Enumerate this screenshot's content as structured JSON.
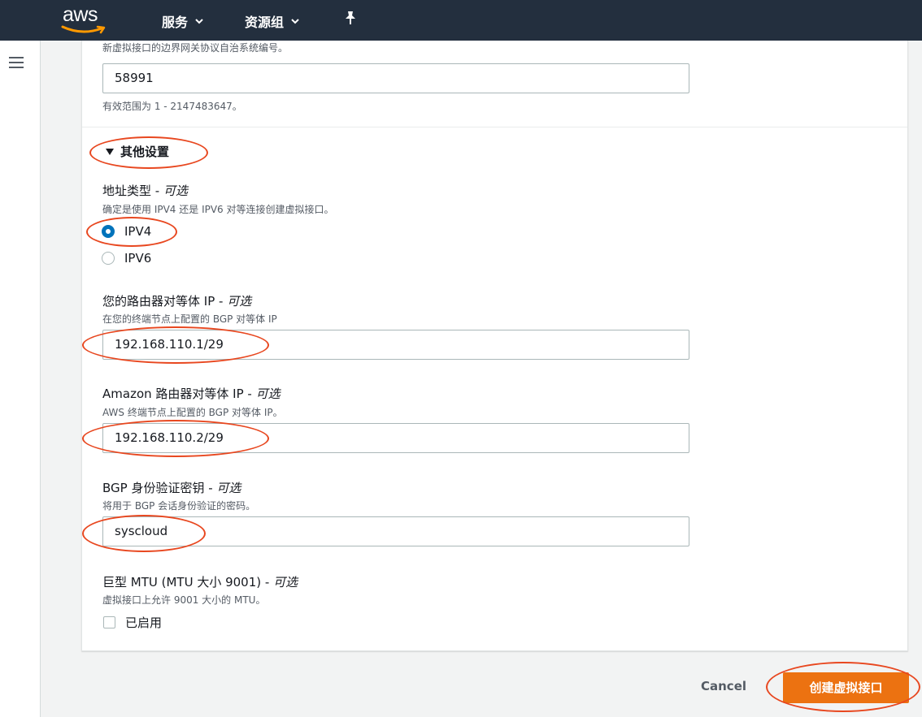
{
  "nav": {
    "logo_text": "aws",
    "services_label": "服务",
    "resource_groups_label": "资源组"
  },
  "asn": {
    "description": "新虚拟接口的边界网关协议自治系统编号。",
    "value": "58991",
    "hint": "有效范围为 1 - 2147483647。"
  },
  "other_settings": {
    "label": "其他设置"
  },
  "address_type": {
    "label": "地址类型 - ",
    "optional": "可选",
    "description": "确定是使用 IPV4 还是 IPV6 对等连接创建虚拟接口。",
    "options": [
      {
        "label": "IPV4",
        "selected": true
      },
      {
        "label": "IPV6",
        "selected": false
      }
    ]
  },
  "router_peer_ip": {
    "label": "您的路由器对等体 IP - ",
    "optional": "可选",
    "description": "在您的终端节点上配置的 BGP 对等体 IP",
    "value": "192.168.110.1/29"
  },
  "amazon_peer_ip": {
    "label": "Amazon 路由器对等体 IP - ",
    "optional": "可选",
    "description": "AWS 终端节点上配置的 BGP 对等体 IP。",
    "value": "192.168.110.2/29"
  },
  "bgp_auth_key": {
    "label": "BGP 身份验证密钥 - ",
    "optional": "可选",
    "description": "将用于 BGP 会话身份验证的密码。",
    "value": "syscloud"
  },
  "jumbo_mtu": {
    "label": "巨型 MTU (MTU 大小 9001) - ",
    "optional": "可选",
    "description": "虚拟接口上允许 9001 大小的 MTU。",
    "checkbox_label": "已启用",
    "checked": false
  },
  "actions": {
    "cancel_label": "Cancel",
    "create_label": "创建虚拟接口"
  },
  "colors": {
    "nav_bg": "#232f3e",
    "primary_button": "#ec7211",
    "radio_selected": "#0073bb",
    "annotation": "#e8471f"
  }
}
